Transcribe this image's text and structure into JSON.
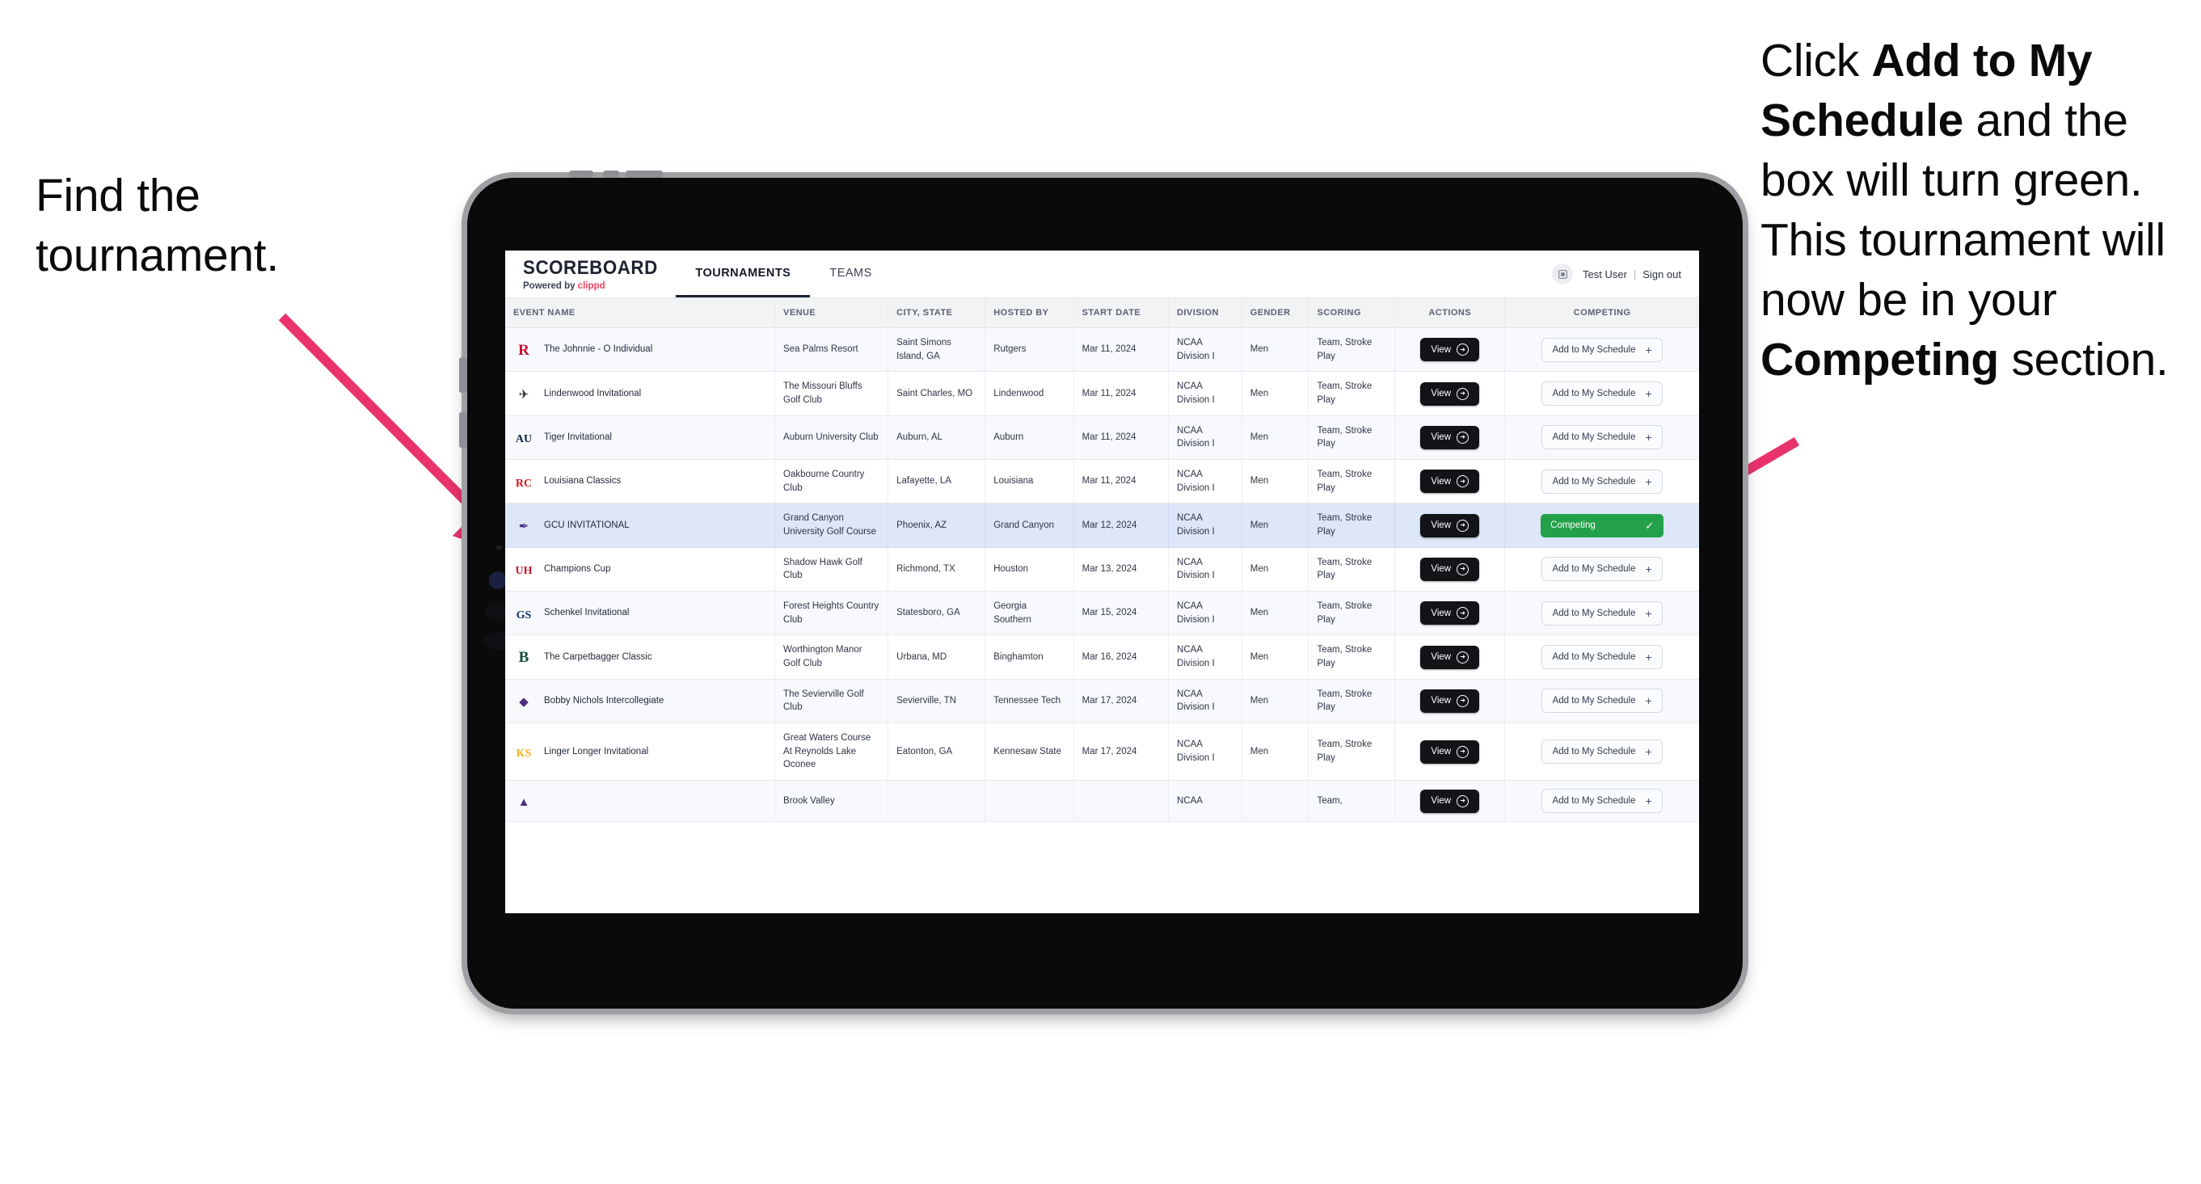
{
  "annotations": {
    "left": "Find the tournament.",
    "right_parts": [
      {
        "t": "Click ",
        "b": false
      },
      {
        "t": "Add to My Schedule",
        "b": true
      },
      {
        "t": " and the box will turn green. This tournament will now be in your ",
        "b": false
      },
      {
        "t": "Competing",
        "b": true
      },
      {
        "t": " section.",
        "b": false
      }
    ],
    "arrow_color": "#e8336d"
  },
  "app": {
    "brand": {
      "title": "SCOREBOARD",
      "subtitle_prefix": "Powered by ",
      "subtitle_brand": "clippd"
    },
    "nav": [
      {
        "label": "TOURNAMENTS",
        "active": true
      },
      {
        "label": "TEAMS",
        "active": false
      }
    ],
    "user": {
      "avatar_icon": "user-avatar-icon",
      "name": "Test User",
      "separator": "|",
      "signout": "Sign out"
    }
  },
  "table": {
    "columns": [
      "EVENT NAME",
      "VENUE",
      "CITY, STATE",
      "HOSTED BY",
      "START DATE",
      "DIVISION",
      "GENDER",
      "SCORING",
      "ACTIONS",
      "COMPETING"
    ],
    "view_label": "View",
    "add_label": "Add to My Schedule",
    "add_plus": "+",
    "competing_label": "Competing",
    "competing_check": "✓",
    "rows": [
      {
        "logo": "rutgers-logo",
        "logo_color": "#c8102e",
        "logo_glyph": "R",
        "event": "The Johnnie - O Individual",
        "venue": "Sea Palms Resort",
        "city": "Saint Simons Island, GA",
        "host": "Rutgers",
        "date": "Mar 11, 2024",
        "division": "NCAA Division I",
        "gender": "Men",
        "scoring": "Team, Stroke Play",
        "competing": false
      },
      {
        "logo": "lindenwood-logo",
        "logo_color": "#2a2a2a",
        "logo_glyph": "✈",
        "event": "Lindenwood Invitational",
        "venue": "The Missouri Bluffs Golf Club",
        "city": "Saint Charles, MO",
        "host": "Lindenwood",
        "date": "Mar 11, 2024",
        "division": "NCAA Division I",
        "gender": "Men",
        "scoring": "Team, Stroke Play",
        "competing": false
      },
      {
        "logo": "auburn-logo",
        "logo_color": "#0c2340",
        "logo_glyph": "AU",
        "event": "Tiger Invitational",
        "venue": "Auburn University Club",
        "city": "Auburn, AL",
        "host": "Auburn",
        "date": "Mar 11, 2024",
        "division": "NCAA Division I",
        "gender": "Men",
        "scoring": "Team, Stroke Play",
        "competing": false
      },
      {
        "logo": "louisiana-logo",
        "logo_color": "#ce181e",
        "logo_glyph": "RC",
        "event": "Louisiana Classics",
        "venue": "Oakbourne Country Club",
        "city": "Lafayette, LA",
        "host": "Louisiana",
        "date": "Mar 11, 2024",
        "division": "NCAA Division I",
        "gender": "Men",
        "scoring": "Team, Stroke Play",
        "competing": false
      },
      {
        "logo": "gcu-logo",
        "logo_color": "#4b2e83",
        "logo_glyph": "✒",
        "event": "GCU INVITATIONAL",
        "venue": "Grand Canyon University Golf Course",
        "city": "Phoenix, AZ",
        "host": "Grand Canyon",
        "date": "Mar 12, 2024",
        "division": "NCAA Division I",
        "gender": "Men",
        "scoring": "Team, Stroke Play",
        "competing": true
      },
      {
        "logo": "houston-logo",
        "logo_color": "#c8102e",
        "logo_glyph": "UH",
        "event": "Champions Cup",
        "venue": "Shadow Hawk Golf Club",
        "city": "Richmond, TX",
        "host": "Houston",
        "date": "Mar 13, 2024",
        "division": "NCAA Division I",
        "gender": "Men",
        "scoring": "Team, Stroke Play",
        "competing": false
      },
      {
        "logo": "georgia-southern-logo",
        "logo_color": "#11326b",
        "logo_glyph": "GS",
        "event": "Schenkel Invitational",
        "venue": "Forest Heights Country Club",
        "city": "Statesboro, GA",
        "host": "Georgia Southern",
        "date": "Mar 15, 2024",
        "division": "NCAA Division I",
        "gender": "Men",
        "scoring": "Team, Stroke Play",
        "competing": false
      },
      {
        "logo": "binghamton-logo",
        "logo_color": "#0d4d3c",
        "logo_glyph": "B",
        "event": "The Carpetbagger Classic",
        "venue": "Worthington Manor Golf Club",
        "city": "Urbana, MD",
        "host": "Binghamton",
        "date": "Mar 16, 2024",
        "division": "NCAA Division I",
        "gender": "Men",
        "scoring": "Team, Stroke Play",
        "competing": false
      },
      {
        "logo": "tennessee-tech-logo",
        "logo_color": "#4f2d7f",
        "logo_glyph": "◆",
        "event": "Bobby Nichols Intercollegiate",
        "venue": "The Sevierville Golf Club",
        "city": "Sevierville, TN",
        "host": "Tennessee Tech",
        "date": "Mar 17, 2024",
        "division": "NCAA Division I",
        "gender": "Men",
        "scoring": "Team, Stroke Play",
        "competing": false
      },
      {
        "logo": "kennesaw-state-logo",
        "logo_color": "#f6b221",
        "logo_glyph": "KS",
        "event": "Linger Longer Invitational",
        "venue": "Great Waters Course At Reynolds Lake Oconee",
        "city": "Eatonton, GA",
        "host": "Kennesaw State",
        "date": "Mar 17, 2024",
        "division": "NCAA Division I",
        "gender": "Men",
        "scoring": "Team, Stroke Play",
        "competing": false
      },
      {
        "logo": "ecu-logo",
        "logo_color": "#4f2d7f",
        "logo_glyph": "▲",
        "event": "",
        "venue": "Brook Valley",
        "city": "",
        "host": "",
        "date": "",
        "division": "NCAA",
        "gender": "",
        "scoring": "Team,",
        "competing": false,
        "clipped": true
      }
    ]
  }
}
